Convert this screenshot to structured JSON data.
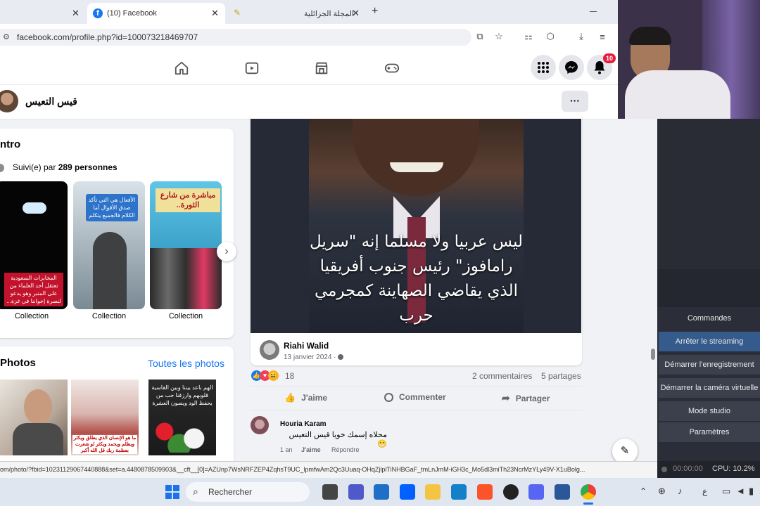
{
  "browser": {
    "tabs": [
      {
        "label": "",
        "close": "✕"
      },
      {
        "label": "(10) Facebook",
        "close": "✕"
      },
      {
        "label": "المجلة الجزائلية",
        "close": "✕"
      }
    ],
    "new_tab": "+",
    "url": "facebook.com/profile.php?id=100073218469707"
  },
  "fb": {
    "notif_count": "10",
    "profile_name": "قيس التعيس",
    "more": "···",
    "intro_title": "ntro",
    "followers_prefix": "Suivi(e) par ",
    "followers_count": "289 personnes",
    "collections": [
      {
        "label": "Collection",
        "overlay": "المخابرات السعودية تعتقل أحد العلماء من على المنبر وهو يدعو لنصرة إخواننا في غزة..."
      },
      {
        "label": "Collection",
        "overlay": "الأفعال هي التي تأكد صدق الأقوال أما الكلام فالجميع يتكلم"
      },
      {
        "label": "Collection",
        "overlay": "مباشرة من شارع الثورة.."
      }
    ],
    "photos_title": "Photos",
    "photos_link": "Toutes les photos",
    "photo_captions": [
      "",
      "ما هو الإنسان الذي يطلق ويكثر ويظلم ويحمد ويكثر لو شعرت بعظمة ربك قل الله أكبر",
      "الهم باعد بيننا وبين القاسية قلوبهم وارزقنا حب من يحفظ الود ويصون العشرة"
    ],
    "post": {
      "image_text": "ليس عربيا ولا مسلما إنه \"سريل رامافوز\" رئيس جنوب أفريقيا الذي يقاضي الصهاينة كمجرمي حرب",
      "author": "Riahi Walid",
      "date": "13 janvier 2024 · ",
      "reactions_count": "18",
      "comments": "2 commentaires",
      "shares": "5 partages",
      "like": "J'aime",
      "comment": "Commenter",
      "share": "Partager"
    },
    "comment": {
      "author": "Houria Karam",
      "text": "محلاه إسمك خويا قيس التعيس 😁",
      "age": "1 an",
      "like": "J'aime",
      "reply": "Répondre"
    }
  },
  "status_url": "om/photo/?fbid=10231129067440888&set=a.4480878509903&__cft__[0]=AZUnp7WsNRFZEP4ZqhsT9UC_lpmfwAm2Qc3Uuaq-OHqZjlplTiNHBGaF_tmLnJmM-iGH3c_Mo5dl3miTh23NcrMzYLy49V-X1uBolg...",
  "obs": {
    "commands_label": "Commandes",
    "buttons": [
      "Arrêter le streaming",
      "Démarrer l'enregistrement",
      "Démarrer la caméra virtuelle",
      "Mode studio",
      "Paramètres"
    ],
    "timer": "00:00:00",
    "cpu": "CPU: 10.2%"
  },
  "taskbar": {
    "search": "Rechercher",
    "lang": "ع"
  },
  "colors": {
    "fb_blue": "#1877f2",
    "notif_red": "#e41e3f",
    "obs_bg": "#2b2e38"
  }
}
